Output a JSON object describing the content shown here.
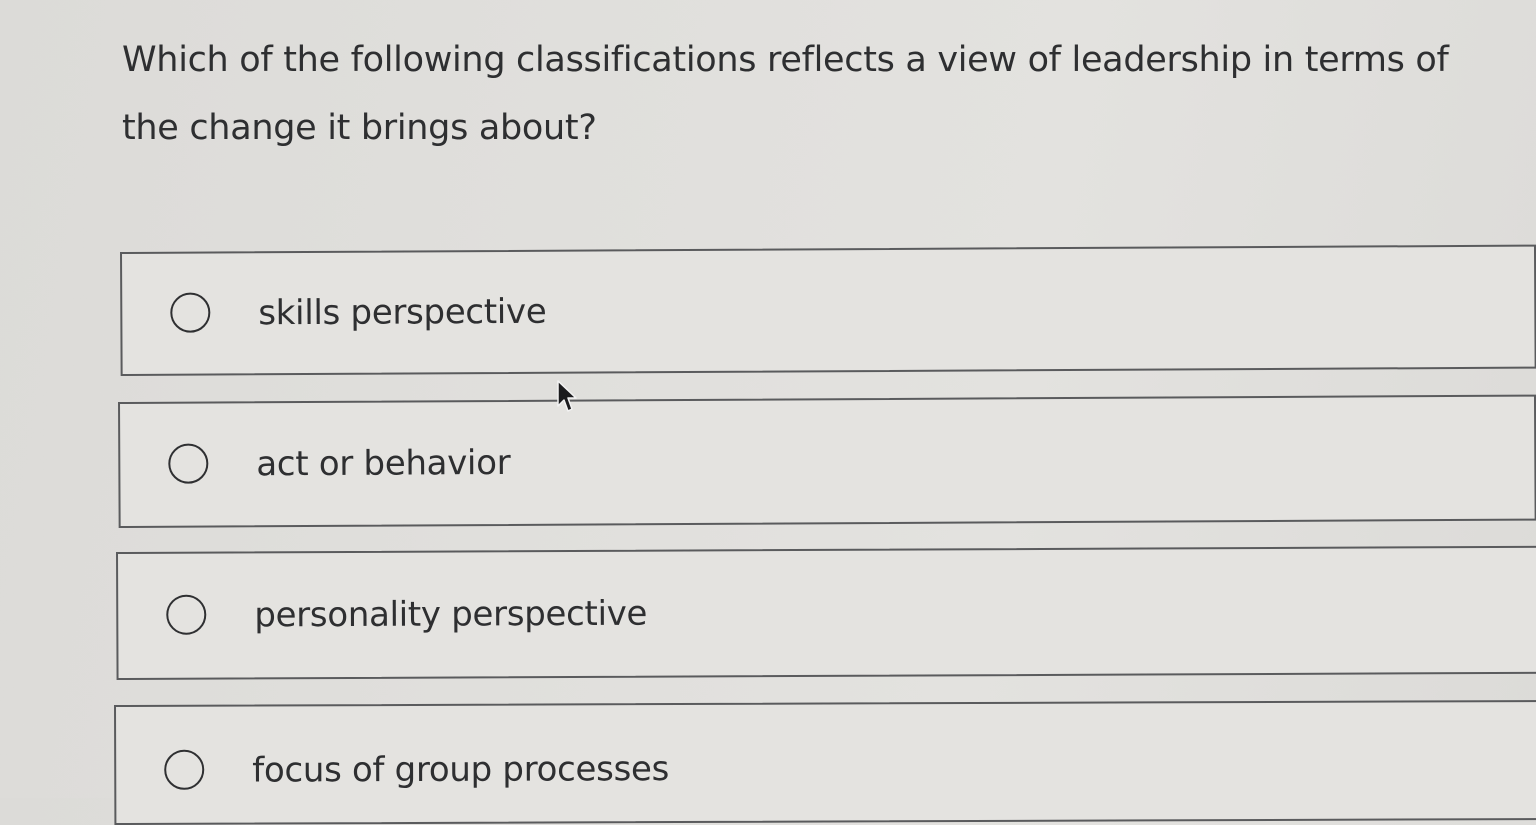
{
  "question": {
    "text": "Which of the following classifications reflects a view of leadership in terms of the change it brings about?"
  },
  "options": [
    {
      "label": "skills perspective",
      "selected": false
    },
    {
      "label": "act or behavior",
      "selected": false
    },
    {
      "label": "personality perspective",
      "selected": false
    },
    {
      "label": "focus of group processes",
      "selected": false
    }
  ],
  "icons": {
    "radio": "radio-button-unselected-icon",
    "cursor": "mouse-pointer-icon"
  },
  "colors": {
    "background": "#e0dfdc",
    "text": "#2e2f31",
    "border": "#5a5b5d"
  }
}
